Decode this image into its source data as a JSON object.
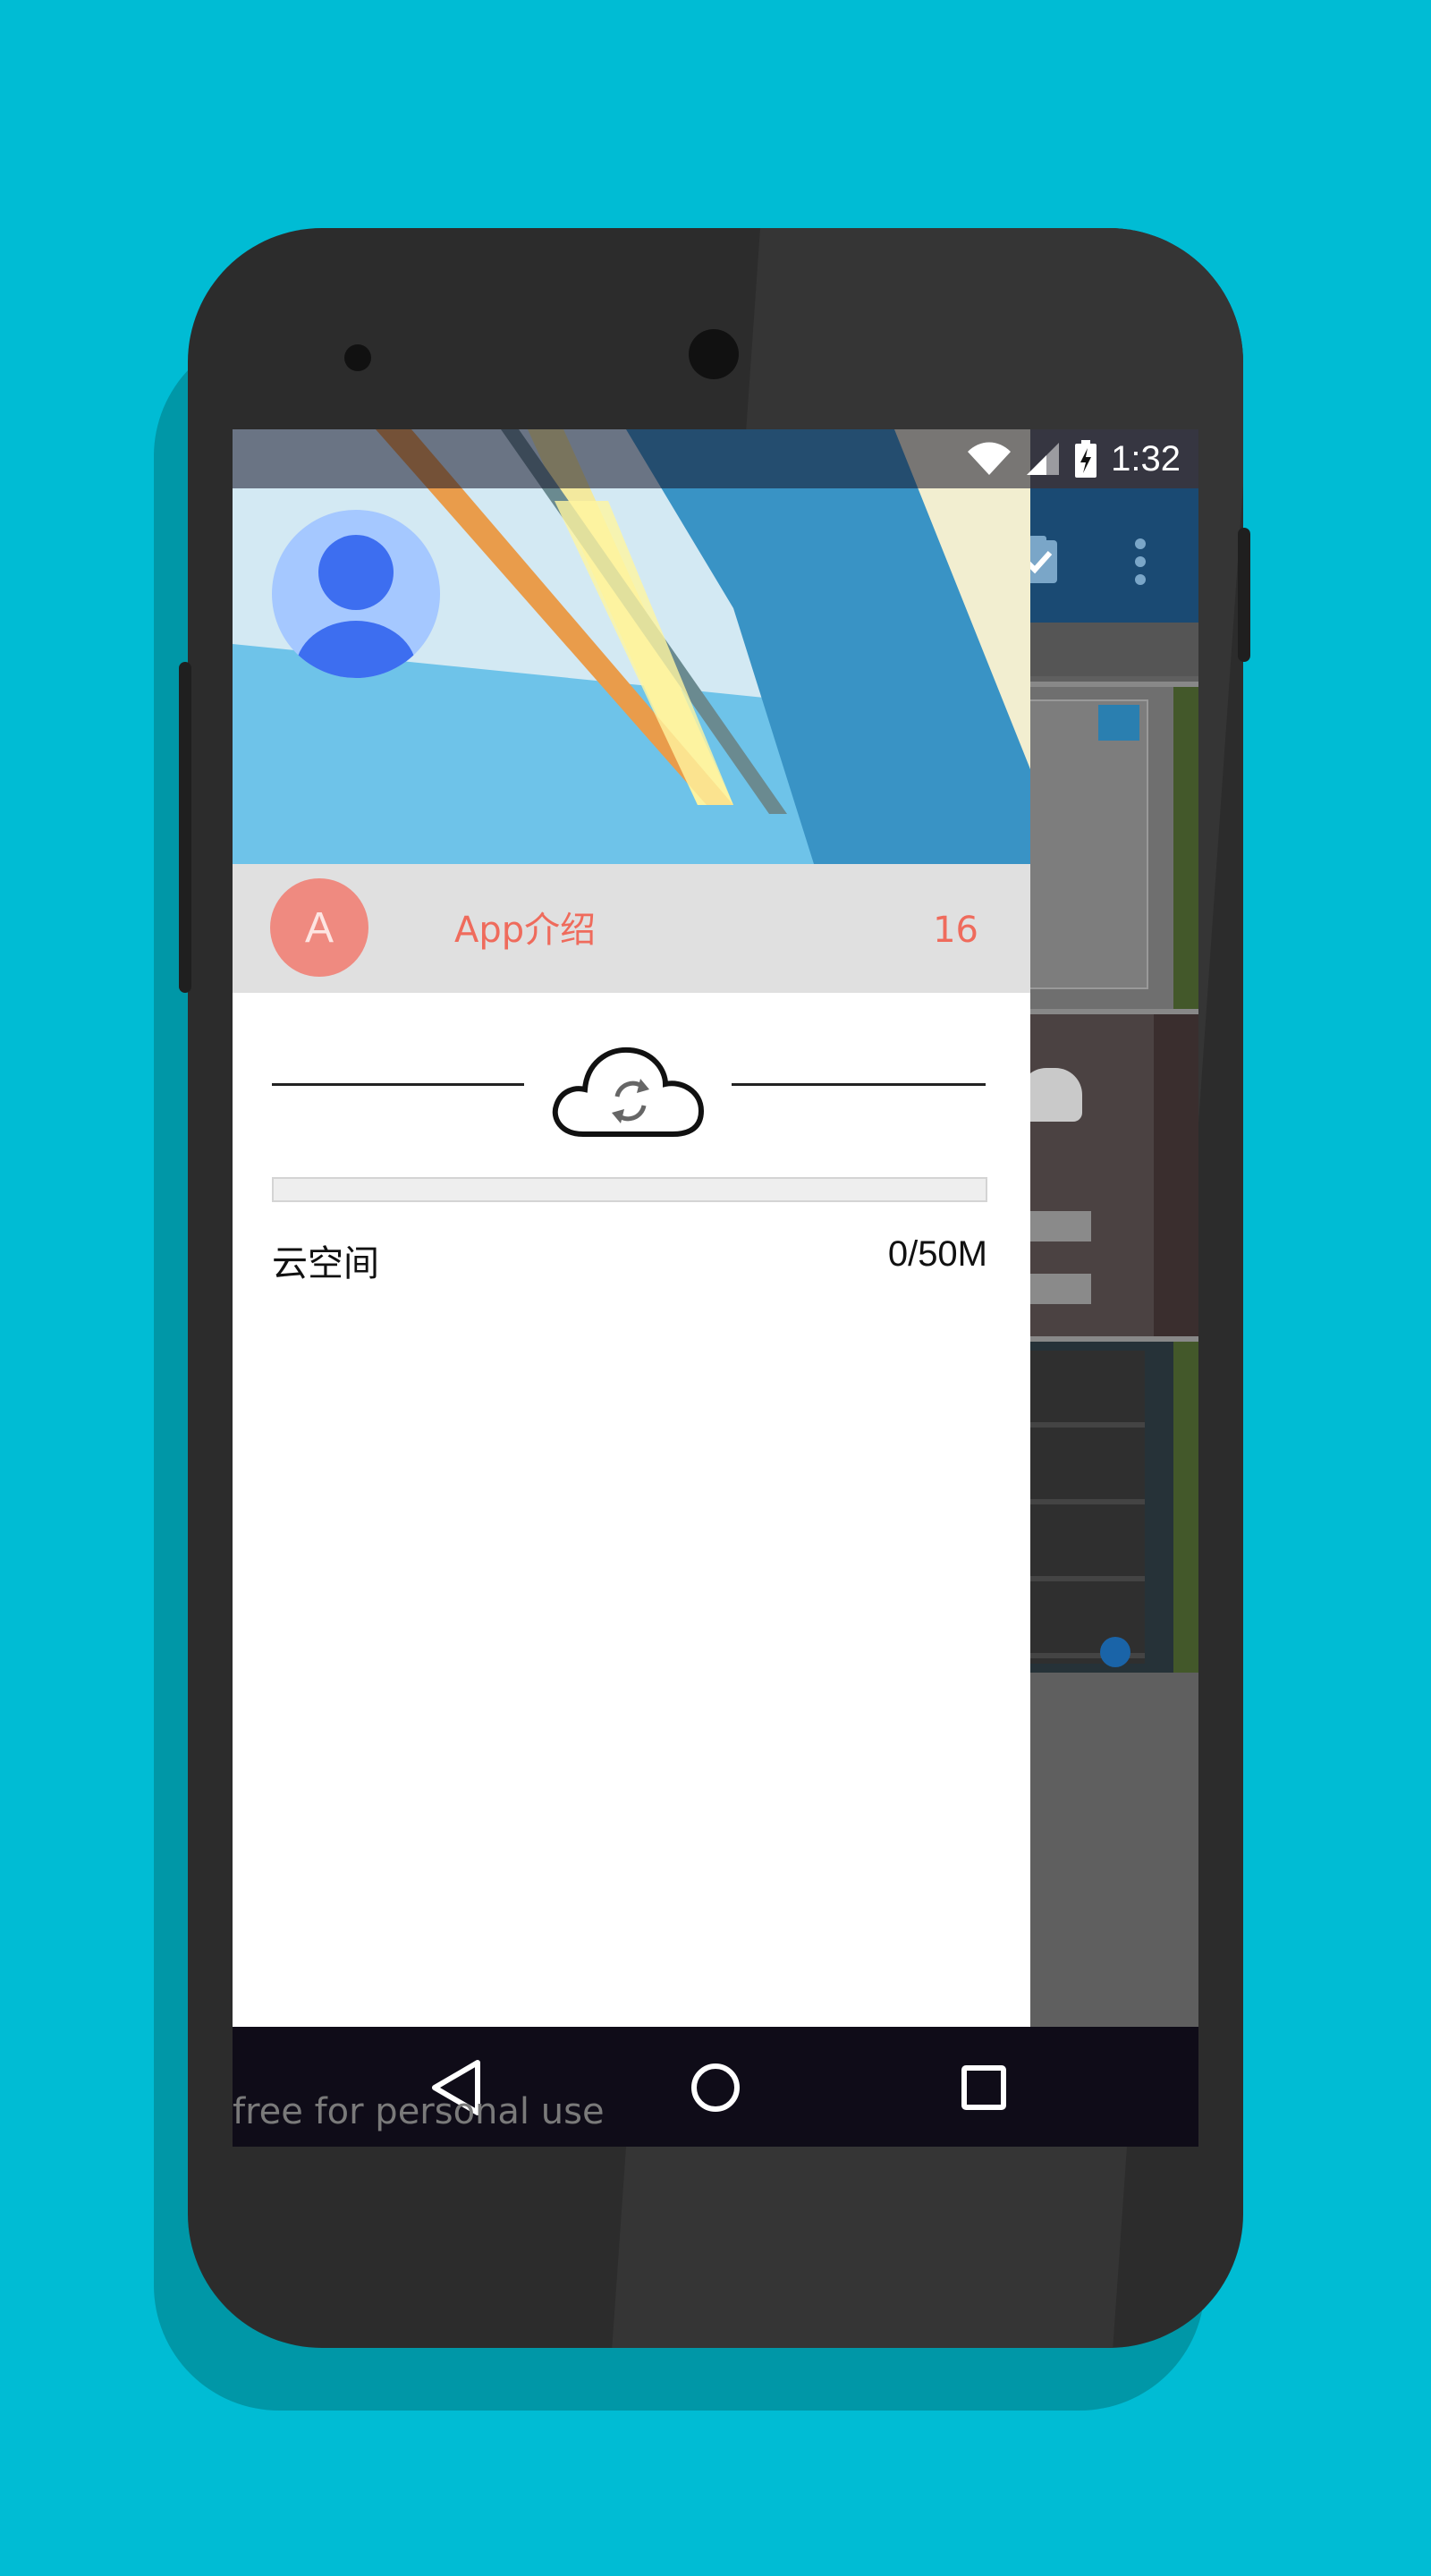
{
  "status_bar": {
    "time": "1:32",
    "icons": [
      "wifi-icon",
      "signal-icon",
      "battery-charging-icon"
    ]
  },
  "drawer": {
    "header": {
      "avatar_icon": "person-avatar-icon"
    },
    "account_row": {
      "letter": "A",
      "label": "App介绍",
      "count": "16"
    },
    "cloud_section": {
      "icon": "cloud-sync-icon",
      "storage_label": "云空间",
      "storage_value": "0/50M",
      "storage_progress": 0
    }
  },
  "background_app": {
    "toolbar_icons": [
      "clipboard-check-icon",
      "more-vert-icon"
    ]
  },
  "nav_bar": {
    "buttons": [
      "back-icon",
      "home-icon",
      "recents-icon"
    ]
  },
  "watermark": "free for personal use",
  "colors": {
    "page_background": "#00bcd4",
    "accent": "#ef6b5c",
    "header_blue": "#3a96c5",
    "avatar_blue": "#3d6ef0"
  }
}
